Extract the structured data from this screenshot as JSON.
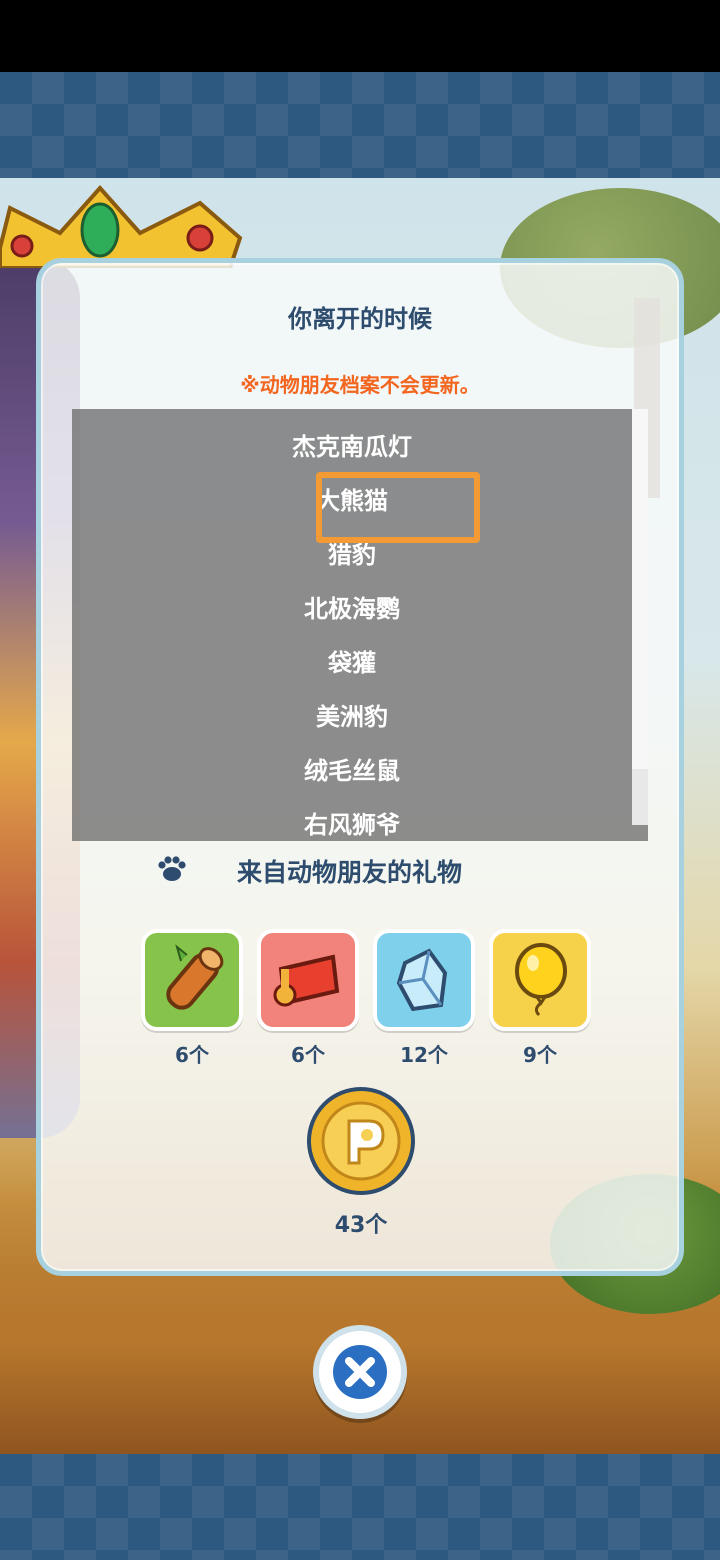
{
  "dialog": {
    "title": "你离开的时候",
    "warning": "※动物朋友档案不会更新。",
    "animals": [
      "杰克南瓜灯",
      "大熊猫",
      "猎豹",
      "北极海鹦",
      "袋獾",
      "美洲豹",
      "绒毛丝鼠",
      "右风狮爷"
    ],
    "highlighted_animal": "大熊猫",
    "gift_section_title": "来自动物朋友的礼物",
    "gifts": [
      {
        "icon": "wood-log-icon",
        "count": "6个",
        "color": "#86c34a"
      },
      {
        "icon": "cloth-roll-icon",
        "count": "6个",
        "color": "#f2837a"
      },
      {
        "icon": "crystal-icon",
        "count": "12个",
        "color": "#7fd0ea"
      },
      {
        "icon": "balloon-icon",
        "count": "9个",
        "color": "#f6d14a"
      }
    ],
    "coin": {
      "icon": "pavilion-coin-icon",
      "count": "43个"
    }
  },
  "colors": {
    "title": "#2e4c6e",
    "warning": "#f2661f",
    "highlight_border": "#f39a34",
    "frame": "#a8d1e0",
    "tile_band": "#2d5880"
  },
  "close_icon": "close-icon"
}
